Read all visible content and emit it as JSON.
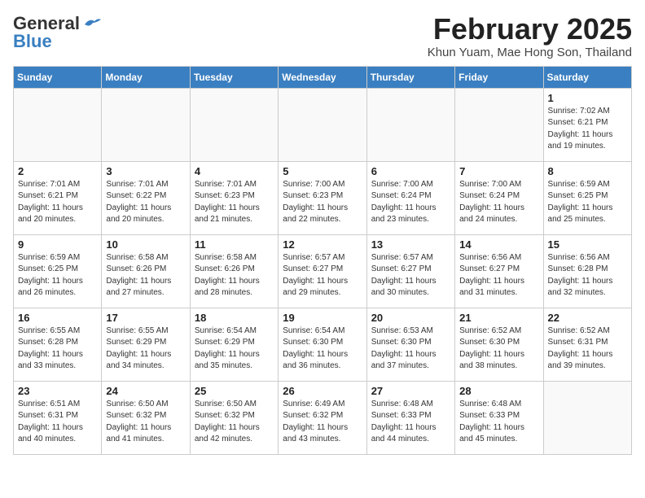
{
  "header": {
    "logo_line1": "General",
    "logo_line2": "Blue",
    "title": "February 2025",
    "subtitle": "Khun Yuam, Mae Hong Son, Thailand"
  },
  "days_of_week": [
    "Sunday",
    "Monday",
    "Tuesday",
    "Wednesday",
    "Thursday",
    "Friday",
    "Saturday"
  ],
  "weeks": [
    [
      {
        "day": "",
        "info": ""
      },
      {
        "day": "",
        "info": ""
      },
      {
        "day": "",
        "info": ""
      },
      {
        "day": "",
        "info": ""
      },
      {
        "day": "",
        "info": ""
      },
      {
        "day": "",
        "info": ""
      },
      {
        "day": "1",
        "info": "Sunrise: 7:02 AM\nSunset: 6:21 PM\nDaylight: 11 hours\nand 19 minutes."
      }
    ],
    [
      {
        "day": "2",
        "info": "Sunrise: 7:01 AM\nSunset: 6:21 PM\nDaylight: 11 hours\nand 20 minutes."
      },
      {
        "day": "3",
        "info": "Sunrise: 7:01 AM\nSunset: 6:22 PM\nDaylight: 11 hours\nand 20 minutes."
      },
      {
        "day": "4",
        "info": "Sunrise: 7:01 AM\nSunset: 6:23 PM\nDaylight: 11 hours\nand 21 minutes."
      },
      {
        "day": "5",
        "info": "Sunrise: 7:00 AM\nSunset: 6:23 PM\nDaylight: 11 hours\nand 22 minutes."
      },
      {
        "day": "6",
        "info": "Sunrise: 7:00 AM\nSunset: 6:24 PM\nDaylight: 11 hours\nand 23 minutes."
      },
      {
        "day": "7",
        "info": "Sunrise: 7:00 AM\nSunset: 6:24 PM\nDaylight: 11 hours\nand 24 minutes."
      },
      {
        "day": "8",
        "info": "Sunrise: 6:59 AM\nSunset: 6:25 PM\nDaylight: 11 hours\nand 25 minutes."
      }
    ],
    [
      {
        "day": "9",
        "info": "Sunrise: 6:59 AM\nSunset: 6:25 PM\nDaylight: 11 hours\nand 26 minutes."
      },
      {
        "day": "10",
        "info": "Sunrise: 6:58 AM\nSunset: 6:26 PM\nDaylight: 11 hours\nand 27 minutes."
      },
      {
        "day": "11",
        "info": "Sunrise: 6:58 AM\nSunset: 6:26 PM\nDaylight: 11 hours\nand 28 minutes."
      },
      {
        "day": "12",
        "info": "Sunrise: 6:57 AM\nSunset: 6:27 PM\nDaylight: 11 hours\nand 29 minutes."
      },
      {
        "day": "13",
        "info": "Sunrise: 6:57 AM\nSunset: 6:27 PM\nDaylight: 11 hours\nand 30 minutes."
      },
      {
        "day": "14",
        "info": "Sunrise: 6:56 AM\nSunset: 6:27 PM\nDaylight: 11 hours\nand 31 minutes."
      },
      {
        "day": "15",
        "info": "Sunrise: 6:56 AM\nSunset: 6:28 PM\nDaylight: 11 hours\nand 32 minutes."
      }
    ],
    [
      {
        "day": "16",
        "info": "Sunrise: 6:55 AM\nSunset: 6:28 PM\nDaylight: 11 hours\nand 33 minutes."
      },
      {
        "day": "17",
        "info": "Sunrise: 6:55 AM\nSunset: 6:29 PM\nDaylight: 11 hours\nand 34 minutes."
      },
      {
        "day": "18",
        "info": "Sunrise: 6:54 AM\nSunset: 6:29 PM\nDaylight: 11 hours\nand 35 minutes."
      },
      {
        "day": "19",
        "info": "Sunrise: 6:54 AM\nSunset: 6:30 PM\nDaylight: 11 hours\nand 36 minutes."
      },
      {
        "day": "20",
        "info": "Sunrise: 6:53 AM\nSunset: 6:30 PM\nDaylight: 11 hours\nand 37 minutes."
      },
      {
        "day": "21",
        "info": "Sunrise: 6:52 AM\nSunset: 6:30 PM\nDaylight: 11 hours\nand 38 minutes."
      },
      {
        "day": "22",
        "info": "Sunrise: 6:52 AM\nSunset: 6:31 PM\nDaylight: 11 hours\nand 39 minutes."
      }
    ],
    [
      {
        "day": "23",
        "info": "Sunrise: 6:51 AM\nSunset: 6:31 PM\nDaylight: 11 hours\nand 40 minutes."
      },
      {
        "day": "24",
        "info": "Sunrise: 6:50 AM\nSunset: 6:32 PM\nDaylight: 11 hours\nand 41 minutes."
      },
      {
        "day": "25",
        "info": "Sunrise: 6:50 AM\nSunset: 6:32 PM\nDaylight: 11 hours\nand 42 minutes."
      },
      {
        "day": "26",
        "info": "Sunrise: 6:49 AM\nSunset: 6:32 PM\nDaylight: 11 hours\nand 43 minutes."
      },
      {
        "day": "27",
        "info": "Sunrise: 6:48 AM\nSunset: 6:33 PM\nDaylight: 11 hours\nand 44 minutes."
      },
      {
        "day": "28",
        "info": "Sunrise: 6:48 AM\nSunset: 6:33 PM\nDaylight: 11 hours\nand 45 minutes."
      },
      {
        "day": "",
        "info": ""
      }
    ]
  ]
}
